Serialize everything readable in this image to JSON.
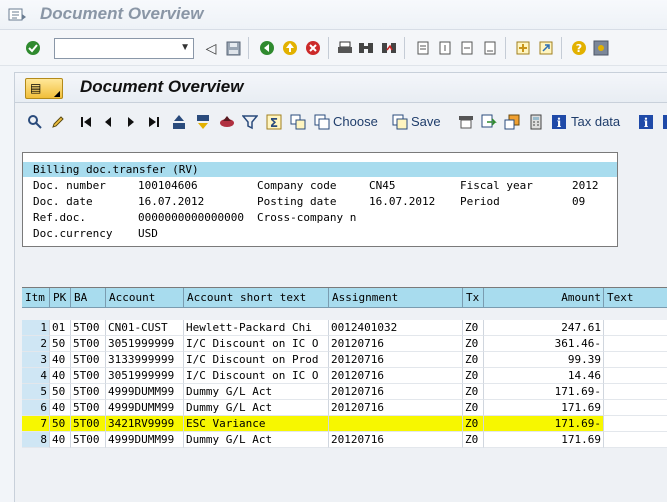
{
  "window": {
    "title": "Document Overview",
    "icon": "window-icon"
  },
  "system_toolbar": {
    "command_field": {
      "value": "",
      "placeholder": ""
    }
  },
  "panel": {
    "title": "Document Overview",
    "choose_label": "Choose",
    "save_label": "Save",
    "tax_data_label": "Tax data"
  },
  "header": {
    "doc_type": "Billing doc.transfer (RV)",
    "doc_number_label": "Doc. number",
    "doc_number": "100104606",
    "company_code_label": "Company code",
    "company_code": "CN45",
    "fiscal_year_label": "Fiscal year",
    "fiscal_year": "2012",
    "doc_date_label": "Doc. date",
    "doc_date": "16.07.2012",
    "posting_date_label": "Posting date",
    "posting_date": "16.07.2012",
    "period_label": "Period",
    "period": "09",
    "ref_doc_label": "Ref.doc.",
    "ref_doc": "0000000000000000",
    "cross_company_label": "Cross-company n",
    "currency_label": "Doc.currency",
    "currency": "USD"
  },
  "table": {
    "columns": {
      "itm": "Itm",
      "pk": "PK",
      "ba": "BA",
      "account": "Account",
      "short_text": "Account short text",
      "assignment": "Assignment",
      "tx": "Tx",
      "amount": "Amount",
      "text": "Text"
    },
    "rows": [
      {
        "itm": "1",
        "pk": "01",
        "ba": "5T00",
        "account": "CN01-CUST",
        "short_text": "Hewlett-Packard Chi",
        "assignment": "0012401032",
        "tx": "Z0",
        "amount": "247.61",
        "text": ""
      },
      {
        "itm": "2",
        "pk": "50",
        "ba": "5T00",
        "account": "3051999999",
        "short_text": "I/C Discount on IC O",
        "assignment": "20120716",
        "tx": "Z0",
        "amount": "361.46-",
        "text": ""
      },
      {
        "itm": "3",
        "pk": "40",
        "ba": "5T00",
        "account": "3133999999",
        "short_text": "I/C Discount on Prod",
        "assignment": "20120716",
        "tx": "Z0",
        "amount": "99.39",
        "text": ""
      },
      {
        "itm": "4",
        "pk": "40",
        "ba": "5T00",
        "account": "3051999999",
        "short_text": "I/C Discount on IC O",
        "assignment": "20120716",
        "tx": "Z0",
        "amount": "14.46",
        "text": ""
      },
      {
        "itm": "5",
        "pk": "50",
        "ba": "5T00",
        "account": "4999DUMM99",
        "short_text": "Dummy G/L Act",
        "assignment": "20120716",
        "tx": "Z0",
        "amount": "171.69-",
        "text": ""
      },
      {
        "itm": "6",
        "pk": "40",
        "ba": "5T00",
        "account": "4999DUMM99",
        "short_text": "Dummy G/L Act",
        "assignment": "20120716",
        "tx": "Z0",
        "amount": "171.69",
        "text": ""
      },
      {
        "itm": "7",
        "pk": "50",
        "ba": "5T00",
        "account": "3421RV9999",
        "short_text": "ESC Variance",
        "assignment": "",
        "tx": "Z0",
        "amount": "171.69-",
        "text": "",
        "highlighted": true
      },
      {
        "itm": "8",
        "pk": "40",
        "ba": "5T00",
        "account": "4999DUMM99",
        "short_text": "Dummy G/L Act",
        "assignment": "20120716",
        "tx": "Z0",
        "amount": "171.69",
        "text": ""
      }
    ]
  },
  "colors": {
    "header_band": "#a8dcee",
    "highlight": "#f7f700",
    "title_gray": "#8a96a6"
  }
}
